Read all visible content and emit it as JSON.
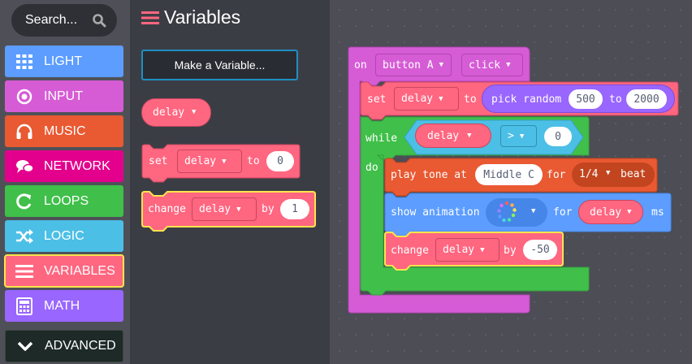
{
  "sidebar": {
    "search": {
      "label": "Search...",
      "icon": "search-icon"
    },
    "categories": [
      {
        "label": "LIGHT",
        "color": "#5c9dff",
        "icon": "grid-icon"
      },
      {
        "label": "INPUT",
        "color": "#d65cd6",
        "icon": "radio-target-icon"
      },
      {
        "label": "MUSIC",
        "color": "#e95932",
        "icon": "headphones-icon"
      },
      {
        "label": "NETWORK",
        "color": "#e3008c",
        "icon": "chat-bubbles-icon"
      },
      {
        "label": "LOOPS",
        "color": "#40bf4a",
        "icon": "refresh-icon"
      },
      {
        "label": "LOGIC",
        "color": "#4cbfe6",
        "icon": "shuffle-icon"
      },
      {
        "label": "VARIABLES",
        "color": "#ff6680",
        "icon": "list-icon",
        "selected": true
      },
      {
        "label": "MATH",
        "color": "#9966ff",
        "icon": "calculator-icon"
      }
    ],
    "advanced": {
      "label": "ADVANCED",
      "icon": "chevron-down-icon"
    }
  },
  "flyout": {
    "title": "Variables",
    "make_variable": "Make a Variable...",
    "blocks": {
      "var_reporter": "delay",
      "set": {
        "set": "set",
        "var": "delay",
        "to": "to",
        "value": "0"
      },
      "change": {
        "change": "change",
        "var": "delay",
        "by": "by",
        "value": "1"
      }
    }
  },
  "workspace": {
    "event": {
      "on": "on",
      "button": "button A",
      "action": "click"
    },
    "set": {
      "set": "set",
      "var": "delay",
      "to": "to",
      "pick_random": "pick random",
      "min": "500",
      "to2": "to",
      "max": "2000"
    },
    "while": {
      "while": "while",
      "var": "delay",
      "op": ">",
      "value": "0",
      "do": "do"
    },
    "tone": {
      "play_tone": "play tone at",
      "note": "Middle C",
      "for": "for",
      "beat": "1/4",
      "beat_label": "beat"
    },
    "animation": {
      "show_animation": "show animation",
      "for": "for",
      "var": "delay",
      "ms": "ms"
    },
    "change": {
      "change": "change",
      "var": "delay",
      "by": "by",
      "value": "-50"
    }
  },
  "colors": {
    "variables": "#ff6680",
    "input": "#d65cd6",
    "loops": "#40bf4a",
    "logic": "#4cbfe6",
    "music": "#e95932",
    "light": "#5c9dff",
    "selection": "#ffe44d"
  }
}
